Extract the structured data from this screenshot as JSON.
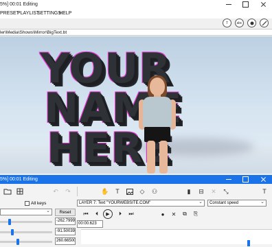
{
  "window": {
    "title": "5%] 00:01 Editing"
  },
  "menu": {
    "items": [
      "PRESET",
      "PLAYLIST",
      "SETTINGS",
      "HELP"
    ]
  },
  "header_controls": [
    "T",
    "abc",
    "rec",
    "edit"
  ],
  "path_bar": {
    "value": "ler\\Media\\Shows\\Mirror\\BigText.bt"
  },
  "preview": {
    "text_lines": [
      "YOUR",
      "NAME",
      "HERE"
    ],
    "colors": {
      "text": "#2e3136",
      "outline": "#e83fd6",
      "hole": "#2aa7e6"
    }
  },
  "editor": {
    "title": "5%] 00:01 Editing",
    "accent": "#1a73e8"
  },
  "toolbar": {
    "icons": [
      "open-folder-icon",
      "grid-icon",
      "undo-icon",
      "redo-icon",
      "hand-icon",
      "text-icon",
      "image-icon",
      "shape-icon",
      "group-icon",
      "align-left-icon",
      "align-center-icon",
      "distribute-icon",
      "transform-icon",
      "text-size-icon"
    ],
    "text_size_label": "T"
  },
  "controls": {
    "all_keys_label": "All keys",
    "reset_label": "Reset",
    "layer_select": "LAYER 7: Text \"YOURWEBSITE.COM\"",
    "speed_select": "Constant speed",
    "values": [
      "-262.79998",
      "-91.500397",
      "260.665001"
    ],
    "time": "00:00.623",
    "sliders": [
      0.23,
      0.25,
      0.34
    ]
  },
  "timeline": {
    "position": 0.87
  }
}
